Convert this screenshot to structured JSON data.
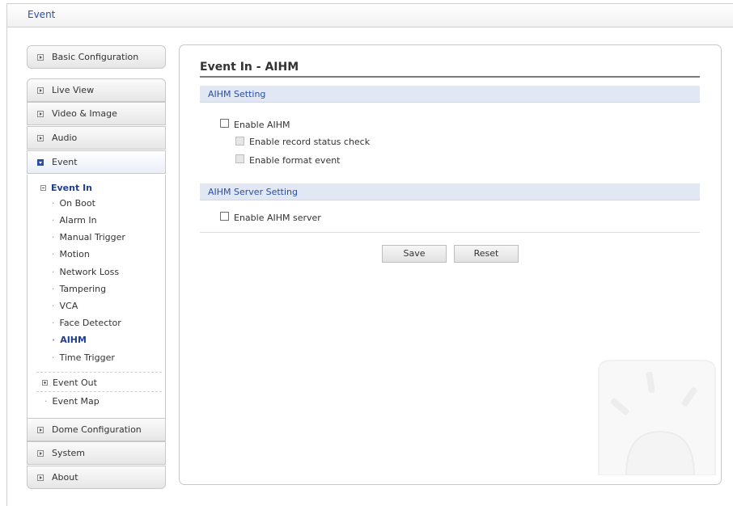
{
  "header": {
    "title": "Event"
  },
  "sidebar": {
    "basic_configuration": "Basic Configuration",
    "live_view": "Live View",
    "video_image": "Video & Image",
    "audio": "Audio",
    "event": "Event",
    "event_in": {
      "label": "Event In",
      "items": [
        "On Boot",
        "Alarm In",
        "Manual Trigger",
        "Motion",
        "Network Loss",
        "Tampering",
        "VCA",
        "Face Detector",
        "AIHM",
        "Time Trigger"
      ],
      "current": "AIHM"
    },
    "event_out": "Event Out",
    "event_map": "Event Map",
    "dome_configuration": "Dome Configuration",
    "system": "System",
    "about": "About"
  },
  "main": {
    "title": "Event In - AIHM",
    "aihm_setting": {
      "header": "AIHM Setting",
      "enable_aihm": "Enable AIHM",
      "enable_record_status_check": "Enable record status check",
      "enable_format_event": "Enable format event"
    },
    "aihm_server_setting": {
      "header": "AIHM Server Setting",
      "enable_aihm_server": "Enable AIHM server"
    },
    "buttons": {
      "save": "Save",
      "reset": "Reset"
    }
  },
  "icons": {
    "sidebar_collapsed": "expand-arrow-icon",
    "sidebar_expanded": "collapse-arrow-icon",
    "watermark": "alarm-beacon-icon"
  },
  "colors": {
    "accent": "#2a4fa0",
    "section_header_bg": "#e1e7f3"
  }
}
